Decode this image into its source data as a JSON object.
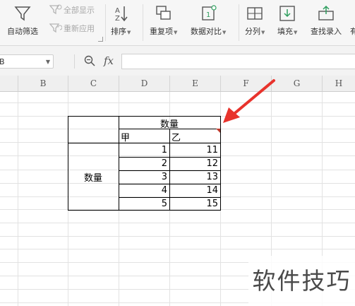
{
  "ribbon": {
    "auto_filter": "自动筛选",
    "show_all": "全部显示",
    "reapply": "重新应用",
    "sort": "排序",
    "duplicates": "重复项",
    "compare": "数据对比",
    "split": "分列",
    "fill": "填充",
    "find_entry": "查找录入",
    "cut_off": "有"
  },
  "formula_bar": {
    "name_box": "B",
    "fx": "fx",
    "formula": ""
  },
  "columns": [
    "B",
    "C",
    "D",
    "E",
    "F",
    "G",
    "H"
  ],
  "table": {
    "header_top": "数量",
    "sub_a": "甲",
    "sub_b": "乙",
    "row_label": "数量",
    "col_d": [
      "1",
      "2",
      "3",
      "4",
      "5"
    ],
    "col_e": [
      "11",
      "12",
      "13",
      "14",
      "15"
    ]
  },
  "watermark": "软件技巧",
  "colors": {
    "arrow": "#e8332c",
    "comment_marker": "#c0392b"
  }
}
